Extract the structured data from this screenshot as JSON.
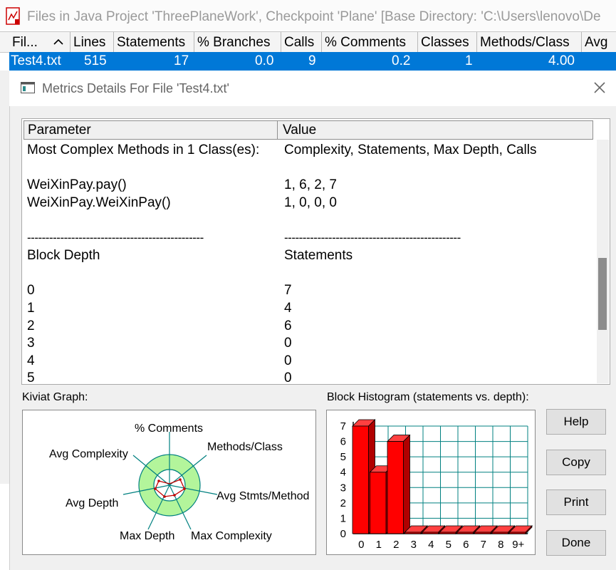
{
  "app_window": {
    "title": "Files in Java Project 'ThreePlaneWork', Checkpoint 'Plane'  [Base Directory: 'C:\\Users\\lenovo\\De",
    "icon": "document-chart-icon"
  },
  "file_table": {
    "columns": [
      "Fil...",
      "Lines",
      "Statements",
      "% Branches",
      "Calls",
      "% Comments",
      "Classes",
      "Methods/Class",
      "Avg"
    ],
    "selected_row": [
      "Test4.txt",
      "515",
      "17",
      "0.0",
      "9",
      "0.2",
      "1",
      "4.00"
    ]
  },
  "dialog": {
    "title": "Metrics Details For File 'Test4.txt'",
    "close_icon": "close-icon",
    "list": {
      "headers": [
        "Parameter",
        "Value"
      ],
      "rows": [
        [
          "Most Complex Methods in 1 Class(es):",
          "Complexity, Statements, Max Depth, Calls"
        ],
        [
          "",
          ""
        ],
        [
          "WeiXinPay.pay()",
          "1, 6, 2, 7"
        ],
        [
          "WeiXinPay.WeiXinPay()",
          "1, 0, 0, 0"
        ],
        [
          "",
          ""
        ],
        [
          "------------------------------------------------",
          "------------------------------------------------"
        ],
        [
          "Block Depth",
          "Statements"
        ],
        [
          "",
          ""
        ],
        [
          "0",
          "7"
        ],
        [
          "1",
          "4"
        ],
        [
          "2",
          "6"
        ],
        [
          "3",
          "0"
        ],
        [
          "4",
          "0"
        ],
        [
          "5",
          "0"
        ]
      ]
    },
    "kiviat": {
      "label": "Kiviat Graph:",
      "axes": [
        "% Comments",
        "Methods/Class",
        "Avg Stmts/Method",
        "Max Complexity",
        "Max Depth",
        "Avg Depth",
        "Avg Complexity"
      ]
    },
    "histogram": {
      "label": "Block Histogram (statements vs. depth):"
    },
    "buttons": {
      "help": "Help",
      "copy": "Copy",
      "print": "Print",
      "done": "Done"
    }
  },
  "chart_data": {
    "type": "bar",
    "categories": [
      "0",
      "1",
      "2",
      "3",
      "4",
      "5",
      "6",
      "7",
      "8",
      "9+"
    ],
    "values": [
      7,
      4,
      6,
      0,
      0,
      0,
      0,
      0,
      0,
      0
    ],
    "y_ticks": [
      "0",
      "1",
      "2",
      "3",
      "4",
      "5",
      "6",
      "7"
    ],
    "ylim": [
      0,
      7
    ],
    "grid": true,
    "bar_color": "#ff0000",
    "grid_color": "#008080"
  },
  "colors": {
    "selection": "#0078d7",
    "kiviat_ring": "#b3f59b",
    "kiviat_axis": "#008080"
  }
}
